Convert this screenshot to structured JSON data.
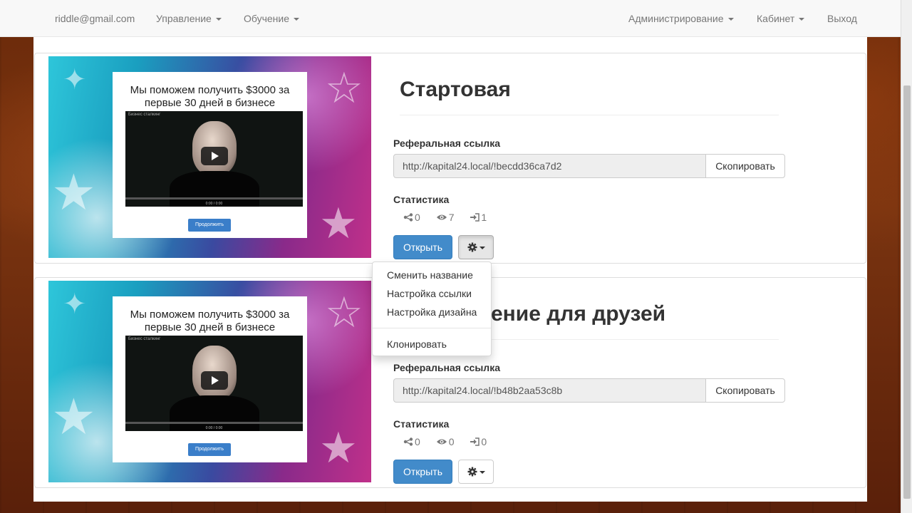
{
  "navbar": {
    "email": "riddle@gmail.com",
    "left_menu": [
      "Управление",
      "Обучение"
    ],
    "right_menu": [
      "Администрирование",
      "Кабинет"
    ],
    "logout": "Выход"
  },
  "pages": [
    {
      "title": "Стартовая",
      "ref_label": "Реферальная ссылка",
      "ref_url": "http://kapital24.local/!becdd36ca7d2",
      "copy_label": "Скопировать",
      "stats_label": "Статистика",
      "shares": "0",
      "views": "7",
      "logins": "1",
      "open_label": "Открыть",
      "preview": {
        "headline": "Мы поможем получить $3000 за первые 30 дней в бизнесе",
        "video_caption": "Бизнес сталкинг",
        "video_time": "0:00 / 0:00",
        "button": "Продолжить"
      }
    },
    {
      "title": "ение для друзей",
      "ref_label": "Реферальная ссылка",
      "ref_url": "http://kapital24.local/!b48b2aa53c8b",
      "copy_label": "Скопировать",
      "stats_label": "Статистика",
      "shares": "0",
      "views": "0",
      "logins": "0",
      "open_label": "Открыть",
      "preview": {
        "headline": "Мы поможем получить $3000 за первые 30 дней в бизнесе",
        "video_caption": "Бизнес сталкинг",
        "video_time": "0:00 / 0:00",
        "button": "Продолжить"
      }
    }
  ],
  "dropdown": {
    "items": [
      "Сменить название",
      "Настройка ссылки",
      "Настройка дизайна"
    ],
    "after_divider": "Клонировать"
  }
}
